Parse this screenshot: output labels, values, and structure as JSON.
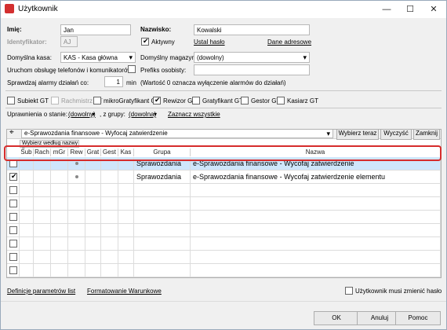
{
  "window": {
    "title": "Użytkownik",
    "minimize": "—",
    "maximize": "☐",
    "close": "✕"
  },
  "form": {
    "imie_label": "Imię:",
    "imie_value": "Jan",
    "nazwisko_label": "Nazwisko:",
    "nazwisko_value": "Kowalski",
    "identyfikator_label": "Identyfikator:",
    "identyfikator_value": "AJ",
    "aktywny_label": "Aktywny",
    "ustal_haslo": "Ustal hasło",
    "dane_adresowe": "Dane adresowe",
    "kasa_label": "Domyślna kasa:",
    "kasa_value": "KAS - Kasa główna",
    "magazyn_label": "Domyślny magazyn:",
    "magazyn_value": "(dowolny)",
    "uruchom_label": "Uruchom obsługę telefonów i komunikatorów",
    "prefiks_label": "Prefiks osobisty:",
    "prefiks_value": "",
    "alarmy_label": "Sprawdzaj alarmy działań co:",
    "alarmy_value": "1",
    "alarmy_unit": "min",
    "alarmy_note": "(Wartość 0 oznacza wyłączenie alarmów do działań)"
  },
  "modules": [
    {
      "label": "Subiekt GT",
      "checked": false,
      "disabled": false
    },
    {
      "label": "Rachmistrz GT",
      "checked": false,
      "disabled": true
    },
    {
      "label": "mikroGratyfikant GT",
      "checked": false,
      "disabled": false
    },
    {
      "label": "Rewizor GT",
      "checked": true,
      "disabled": false
    },
    {
      "label": "Gratyfikant GT",
      "checked": false,
      "disabled": false
    },
    {
      "label": "Gestor GT",
      "checked": false,
      "disabled": false
    },
    {
      "label": "Kasiarz GT",
      "checked": false,
      "disabled": false
    }
  ],
  "filters": {
    "stan_label": "Uprawnienia o stanie:",
    "stan_value": "(dowolny)",
    "grupa_label": ", z grupy:",
    "grupa_value": "(dowolna)",
    "zaznacz": "Zaznacz wszystkie"
  },
  "search": {
    "value": "e-Sprawozdania finansowe - Wyfocaj zatwierdzenie",
    "wybierz_btn": "Wybierz teraz",
    "wyczysc_btn": "Wyczyść",
    "zamknij_btn": "Zamknij",
    "wybierz_wedlug": "Wybierz według nazwy"
  },
  "grid": {
    "columns": [
      "Sub",
      "Rach",
      "mGr",
      "Rew",
      "Grat",
      "Gest",
      "Kas",
      "Grupa",
      "Nazwa"
    ],
    "rows": [
      {
        "checked": false,
        "rew_dot": true,
        "grupa": "Sprawozdania",
        "nazwa": "e-Sprawozdania finansowe - Wycofaj zatwierdzenie"
      },
      {
        "checked": true,
        "rew_dot": true,
        "grupa": "Sprawozdania",
        "nazwa": "e-Sprawozdania finansowe - Wycofaj zatwierdzenie elementu"
      }
    ]
  },
  "bottom": {
    "definicje": "Definicje parametrów list",
    "formatowanie": "Formatowanie Warunkowe",
    "musi_zmienic": "Użytkownik musi zmienić hasło",
    "ok": "OK",
    "anuluj": "Anuluj",
    "pomoc": "Pomoc"
  }
}
